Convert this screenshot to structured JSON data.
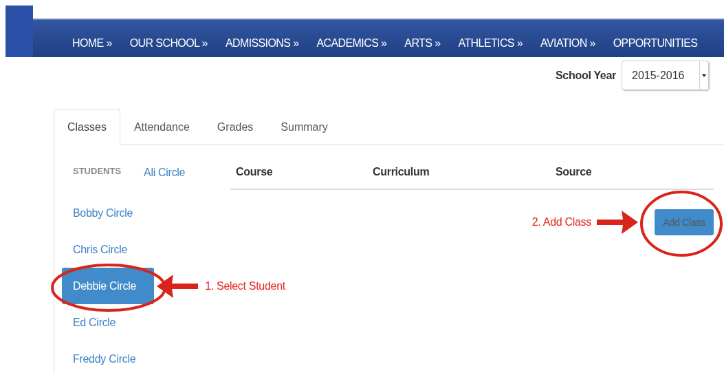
{
  "nav": {
    "items": [
      "HOME »",
      "OUR SCHOOL »",
      "ADMISSIONS »",
      "ACADEMICS »",
      "ARTS »",
      "ATHLETICS »",
      "AVIATION »",
      "OPPORTUNITIES"
    ]
  },
  "school_year": {
    "label": "School Year",
    "value": "2015-2016"
  },
  "tabs": [
    {
      "label": "Classes",
      "selected": true
    },
    {
      "label": "Attendance",
      "selected": false
    },
    {
      "label": "Grades",
      "selected": false
    },
    {
      "label": "Summary",
      "selected": false
    }
  ],
  "students": {
    "heading": "STUDENTS",
    "items": [
      {
        "name": "Ali Circle",
        "selected": false
      },
      {
        "name": "Bobby Circle",
        "selected": false
      },
      {
        "name": "Chris Circle",
        "selected": false
      },
      {
        "name": "Debbie Circle",
        "selected": true,
        "callout": "1. Select Student"
      },
      {
        "name": "Ed Circle",
        "selected": false
      },
      {
        "name": "Freddy Circle",
        "selected": false
      }
    ]
  },
  "table": {
    "columns": [
      "Course",
      "Curriculum",
      "Source"
    ]
  },
  "add_button": {
    "label": "Add Class",
    "callout": "2. Add Class"
  }
}
